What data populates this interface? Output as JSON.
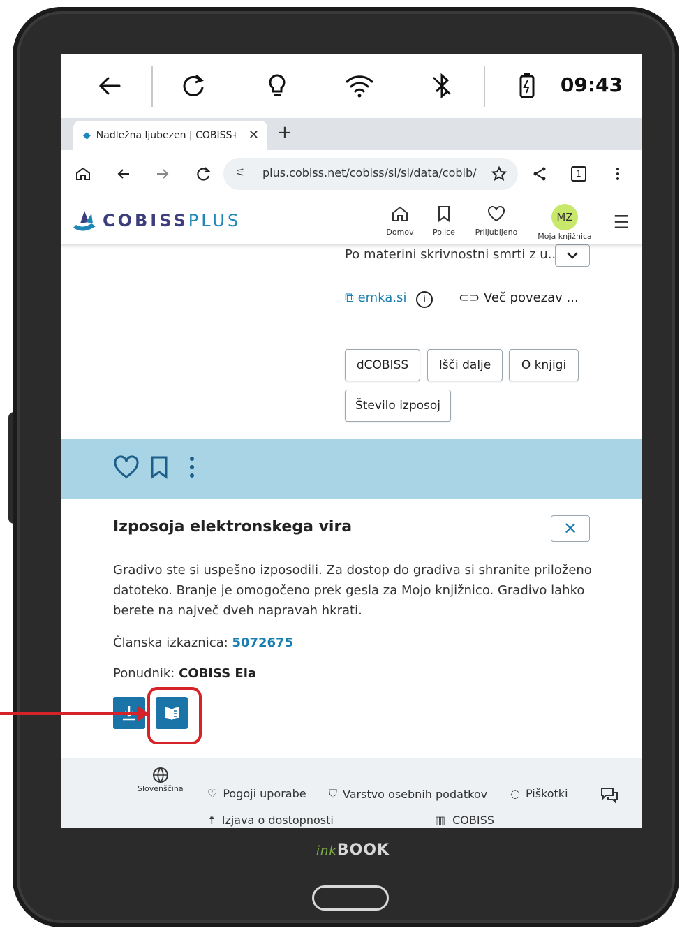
{
  "status_bar": {
    "time": "09:43",
    "icons": [
      "back-arrow-icon",
      "refresh-icon",
      "bulb-icon",
      "wifi-icon",
      "bluetooth-icon",
      "battery-icon"
    ]
  },
  "browser": {
    "tab_title": "Nadležna ljubezen | COBISS+",
    "url": "plus.cobiss.net/cobiss/si/sl/data/cobib/",
    "tab_count": "1"
  },
  "site_header": {
    "logo_bold": "COBISS",
    "logo_plus": "PLUS",
    "nav": [
      {
        "label": "Domov"
      },
      {
        "label": "Police"
      },
      {
        "label": "Priljubljeno"
      },
      {
        "label": "Moja knjižnica"
      }
    ],
    "avatar_initials": "MZ"
  },
  "content": {
    "dropdown_text": "Po materini skrivnostni smrti z u...",
    "link_emka": "emka.si",
    "link_more": "Več povezav ...",
    "buttons": [
      "dCOBISS",
      "Išči dalje",
      "O knjigi",
      "Število izposoj"
    ]
  },
  "panel": {
    "title": "Izposoja elektronskega vira",
    "text": "Gradivo ste si uspešno izposodili. Za dostop do gradiva si shranite priloženo datoteko. Branje je omogočeno prek gesla za Mojo knjižnico. Gradivo lahko berete na največ dveh napravah hkrati.",
    "card_label": "Članska izkaznica:",
    "card_value": "5072675",
    "provider_label": "Ponudnik:",
    "provider_value": "COBISS Ela"
  },
  "footer": {
    "language": "Slovenščina",
    "terms": "Pogoji uporabe",
    "privacy": "Varstvo osebnih podatkov",
    "cookies": "Piškotki",
    "accessibility": "Izjava o dostopnosti",
    "cobiss": "COBISS"
  },
  "device": {
    "brand_ink": "ink",
    "brand_book": "BOOK"
  },
  "colors": {
    "accent": "#1b74a8",
    "highlight": "#d6232a",
    "bluebar": "#a8d4e6",
    "avatar": "#c7e86b"
  }
}
